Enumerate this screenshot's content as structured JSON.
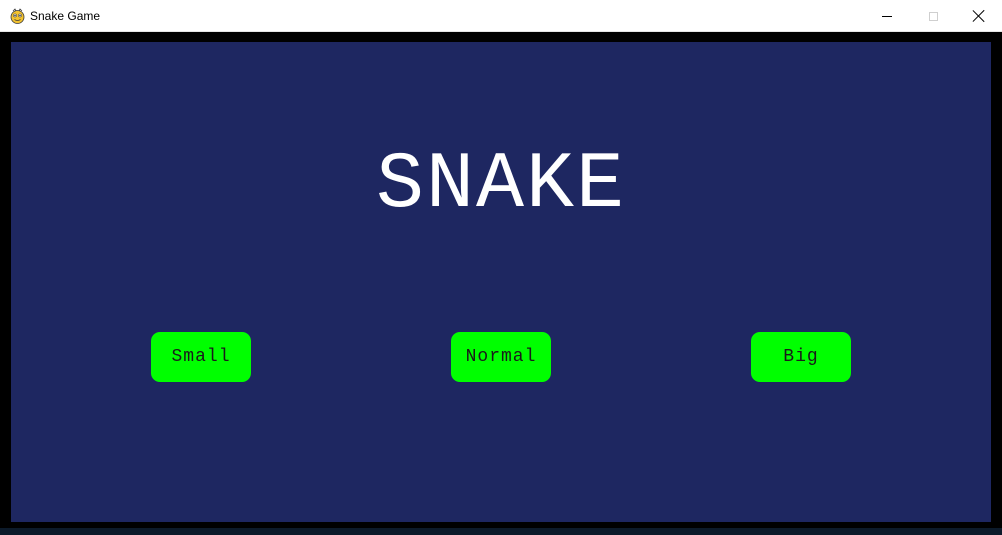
{
  "window": {
    "title": "Snake Game",
    "icon": "pygame-snake-icon",
    "controls": {
      "minimize_icon": "minimize-icon",
      "maximize_icon": "maximize-icon",
      "close_icon": "close-icon"
    }
  },
  "game": {
    "title": "SNAKE",
    "buttons": [
      {
        "label": "Small"
      },
      {
        "label": "Normal"
      },
      {
        "label": "Big"
      }
    ]
  },
  "colors": {
    "background": "#1e2761",
    "title_text": "#ffffff",
    "button_fill": "#00ff00",
    "button_text": "#1a1a1a",
    "frame": "#000000"
  }
}
